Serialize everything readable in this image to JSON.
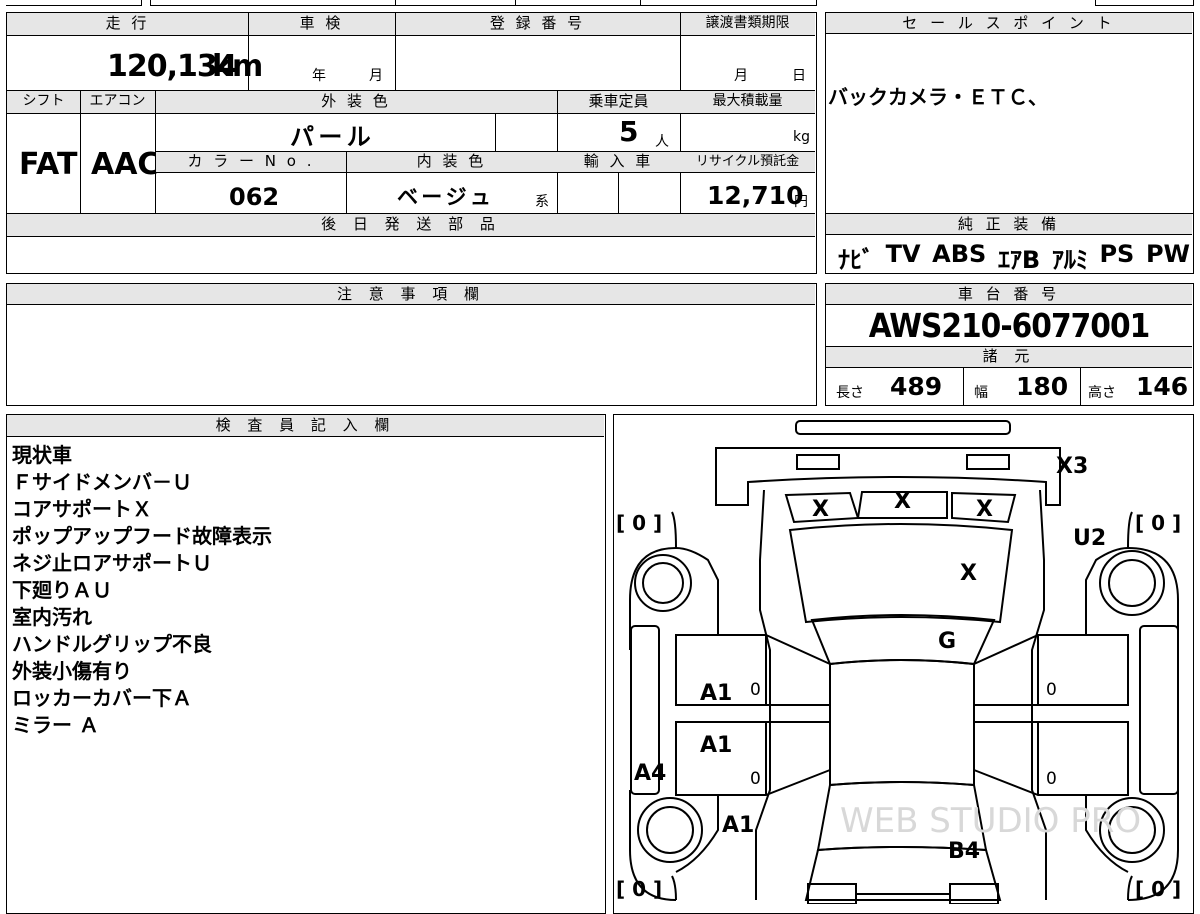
{
  "top_block": {
    "headers": {
      "mileage": "走 行",
      "shaken": "車 検",
      "registration": "登 録 番 号",
      "transfer_deadline": "譲渡書類期限",
      "shift": "シフト",
      "aircon": "エアコン",
      "exterior_color": "外 装 色",
      "capacity": "乗車定員",
      "max_load": "最大積載量",
      "color_no": "カ ラ ー N o .",
      "interior_color": "内 装 色",
      "import": "輸 入 車",
      "recycle": "リサイクル預託金",
      "parts_later": "後 日 発 送 部 品"
    },
    "mileage_value": "120,134",
    "mileage_unit": "km",
    "shaken_year": "年",
    "shaken_month": "月",
    "deadline_month": "月",
    "deadline_day": "日",
    "shift_value": "FAT",
    "aircon_value": "AAC",
    "exterior_value": "パ ー ル",
    "capacity_value": "5",
    "capacity_unit": "人",
    "max_load_unit": "kg",
    "color_no_value": "062",
    "interior_value": "ベ ー ジ ュ",
    "interior_suffix": "系",
    "recycle_value": "12,710",
    "recycle_unit": "円"
  },
  "sales_point": {
    "header": "セ ー ル ス ポ イ ン ト",
    "text": "バックカメラ・ＥＴＣ、"
  },
  "equipment": {
    "header": "純 正 装 備",
    "items": [
      "ﾅﾋﾞ",
      "TV",
      "ABS",
      "ｴｱB",
      "ｱﾙﾐ",
      "PS",
      "PW"
    ]
  },
  "notes_box": {
    "header": "注 意 事 項 欄"
  },
  "chassis": {
    "header": "車 台 番 号",
    "number": "AWS210-6077001",
    "spec_header": "諸 元",
    "length_label": "長さ",
    "length_value": "489",
    "width_label": "幅",
    "width_value": "180",
    "height_label": "高さ",
    "height_value": "146"
  },
  "inspector": {
    "header": "検 査 員 記 入 欄",
    "lines": [
      "現状車",
      "Ｆサイドメンバ－Ｕ",
      "コアサポートＸ",
      "ポップアップフード故障表示",
      "ネジ止ロアサポートＵ",
      "下廻りＡＵ",
      "室内汚れ",
      "ハンドルグリップ不良",
      "外装小傷有り",
      "ロッカーカバー下Ａ",
      "ミラー Ａ"
    ]
  },
  "diagram": {
    "tire_fl": "[ 0 ]",
    "tire_fr": "[ 0 ]",
    "tire_rl": "[ 0 ]",
    "tire_rr": "[ 0 ]",
    "marks": {
      "x3": "X3",
      "x_left": "X",
      "x_center": "X",
      "x_right": "X",
      "u2": "U2",
      "hood": "X",
      "g": "G",
      "a1_front_door": "A1",
      "a1_rear_door": "A1",
      "a4": "A4",
      "a1_rear": "A1",
      "b4": "B4"
    },
    "door_zeros": [
      "0",
      "0",
      "0",
      "0"
    ]
  }
}
